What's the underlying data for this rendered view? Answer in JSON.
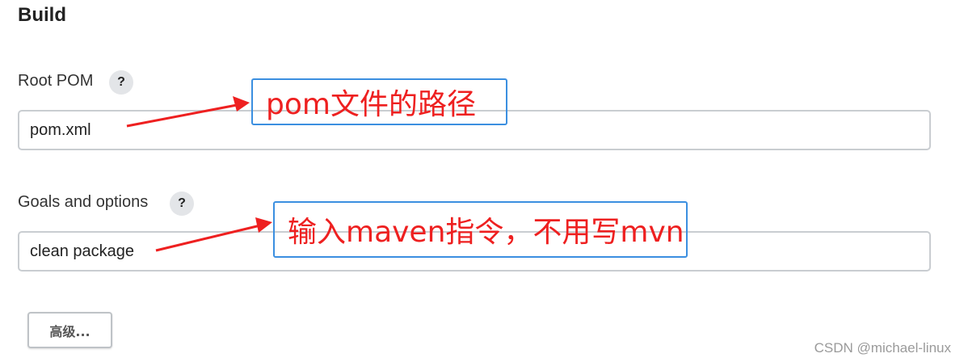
{
  "section": {
    "title": "Build"
  },
  "root_pom": {
    "label": "Root POM",
    "help": "?",
    "value": "pom.xml"
  },
  "goals": {
    "label": "Goals and options",
    "help": "?",
    "value": "clean package"
  },
  "advanced_button": {
    "label": "高级..."
  },
  "annotations": {
    "pom_note": "pom文件的路径",
    "goals_note": "输入maven指令，不用写mvn",
    "color": "#ee2020",
    "box_color": "#3b8fe0"
  },
  "watermark": "CSDN @michael-linux"
}
